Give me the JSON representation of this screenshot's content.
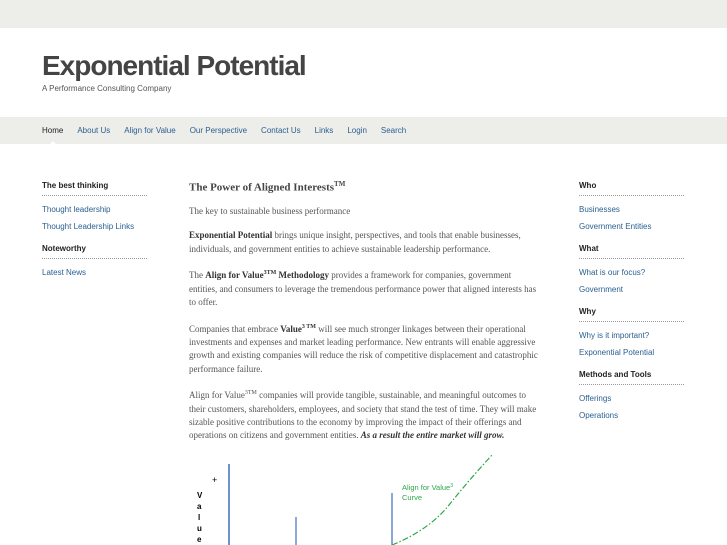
{
  "site": {
    "title": "Exponential Potential",
    "tagline": "A Performance Consulting Company"
  },
  "nav": {
    "items": [
      "Home",
      "About Us",
      "Align for Value",
      "Our Perspective",
      "Contact Us",
      "Links",
      "Login",
      "Search"
    ],
    "active": "Home"
  },
  "left_sidebar": {
    "groups": [
      {
        "heading": "The best thinking",
        "links": [
          "Thought leadership",
          "Thought Leadership Links"
        ]
      },
      {
        "heading": "Noteworthy",
        "links": [
          "Latest News"
        ]
      }
    ]
  },
  "right_sidebar": {
    "groups": [
      {
        "heading": "Who",
        "links": [
          "Businesses",
          "Government Entities"
        ]
      },
      {
        "heading": "What",
        "links": [
          "What is our focus?",
          "Government"
        ]
      },
      {
        "heading": "Why",
        "links": [
          "Why is it important?",
          "Exponential Potential"
        ]
      },
      {
        "heading": "Methods and Tools",
        "links": [
          "Offerings",
          "Operations"
        ]
      }
    ]
  },
  "content": {
    "title": "The Power of Aligned Interests",
    "title_sup": "TM",
    "intro": "The key to sustainable business performance",
    "p1_bold": "Exponential Potential",
    "p1_rest": " brings unique insight, perspectives, and tools that enable businesses, individuals, and government entities to achieve sustainable leadership performance.",
    "p2_pre": "The ",
    "p2_bold": "Align for Value",
    "p2_sup": "3TM",
    "p2_bold2": " Methodology",
    "p2_rest": " provides a framework for companies, government entities, and consumers to leverage the tremendous performance power that aligned interests has to offer.",
    "p3_pre": "Companies that embrace ",
    "p3_bold": "Value",
    "p3_sup": "3 TM",
    "p3_rest": " will see much stronger linkages between their operational investments and expenses and market leading performance.  New entrants will enable aggressive growth and existing companies will reduce the risk of competitive displacement and catastrophic performance failure.",
    "p4_pre": "Align for Value",
    "p4_sup": "3TM",
    "p4_rest": " companies will provide tangible, sustainable, and meaningful outcomes to their customers, shareholders, employees, and society that stand the test of time.  They will make sizable positive contributions to the economy by improving the impact of their offerings and operations on citizens and government entities.  ",
    "p4_emph": "As a result the entire market will grow."
  },
  "figure": {
    "plus": "+",
    "axis_letters": [
      "V",
      "a",
      "l",
      "u",
      "e"
    ],
    "curve_label_1": "Align for Value",
    "curve_label_sup": "3",
    "curve_label_2": "Curve",
    "colors": {
      "axis": "#3b6fc2",
      "curve": "#2aa84a",
      "label": "#2aa84a"
    }
  }
}
